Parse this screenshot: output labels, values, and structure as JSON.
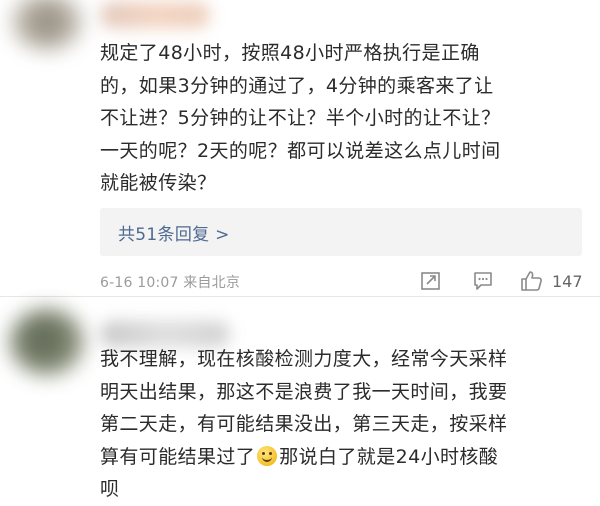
{
  "comments": [
    {
      "lines": [
        "规定了48小时，按照48小时严格执行是正确",
        "的，如果3分钟的通过了，4分钟的乘客来了让",
        "不让进？5分钟的让不让？半个小时的让不让？",
        "一天的呢？2天的呢？都可以说差这么点儿时间",
        "就能被传染？"
      ],
      "replies_label": "共51条回复 >",
      "timestamp": "6-16 10:07 来自北京",
      "like_count": "147",
      "icons": [
        "share-icon",
        "comment-icon",
        "like-icon"
      ]
    },
    {
      "lines": [
        "我不理解，现在核酸检测力度大，经常今天采样",
        "明天出结果，那这不是浪费了我一天时间，我要",
        "第二天走，有可能结果没出，第三天走，按采样",
        "算有可能结果过了",
        "那说白了就是24小时核酸",
        "呗"
      ],
      "emoji": "smile-emoji"
    }
  ]
}
